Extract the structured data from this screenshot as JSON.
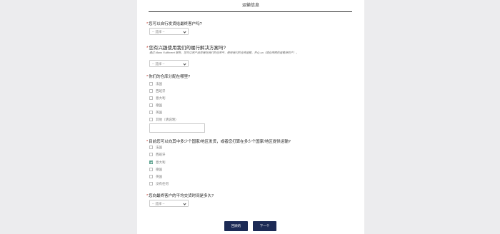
{
  "section": {
    "title": "运输信息"
  },
  "q1": {
    "label": "您可以自行发货给最终客户吗?",
    "select_value": "-- 选择 --"
  },
  "q2": {
    "label": "您有兴趣使用我们的履行解决方案吗?",
    "hint": "通过 Mano Fulfilment 服务，您可以将产品存储在我们的仓库中，使用我们的仓库运输，并让 ua（或仓库网的运输商的产）。",
    "select_value": "-- 选择 --"
  },
  "q3": {
    "label": "你们的仓库分配在哪里?",
    "options": [
      {
        "label": "法国",
        "checked": false
      },
      {
        "label": "西班牙",
        "checked": false
      },
      {
        "label": "意大利",
        "checked": false
      },
      {
        "label": "德国",
        "checked": false
      },
      {
        "label": "英国",
        "checked": false
      },
      {
        "label": "其他（请说明）",
        "checked": false
      }
    ],
    "other_value": ""
  },
  "q4": {
    "label": "目前您可以向其中多少个国家/地区发货，或者您打算在多少个国家/地区提供运输?",
    "options": [
      {
        "label": "法国",
        "checked": false
      },
      {
        "label": "西班牙",
        "checked": false
      },
      {
        "label": "意大利",
        "checked": true
      },
      {
        "label": "德国",
        "checked": false
      },
      {
        "label": "英国",
        "checked": false
      },
      {
        "label": "没有任何",
        "checked": false
      }
    ]
  },
  "q5": {
    "label": "您向最终客户的平均交货时间是多久?",
    "select_value": "-- 选择 --"
  },
  "buttons": {
    "back": "回顾的",
    "next": "下一个"
  },
  "colors": {
    "accent": "#1c2a55",
    "checked": "#5ea28f",
    "required": "#c0392b"
  }
}
